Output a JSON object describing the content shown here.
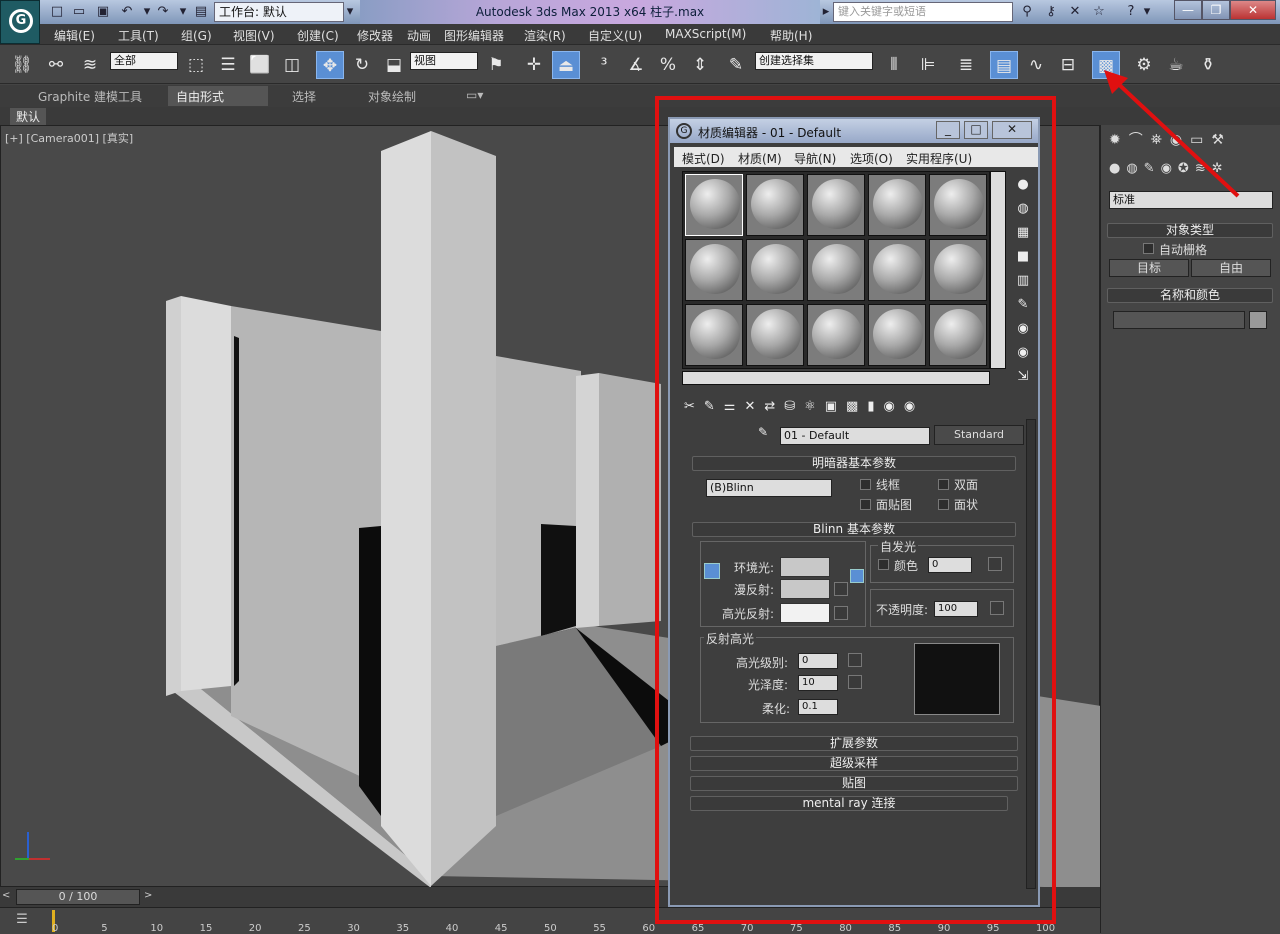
{
  "app": {
    "logo_letter": "G",
    "workspace": "工作台: 默认",
    "title": "Autodesk 3ds Max  2013 x64      柱子.max",
    "search_placeholder": "键入关键字或短语"
  },
  "menu": [
    "编辑(E)",
    "工具(T)",
    "组(G)",
    "视图(V)",
    "创建(C)",
    "修改器",
    "动画",
    "图形编辑器",
    "渲染(R)",
    "自定义(U)",
    "MAXScript(M)",
    "帮助(H)"
  ],
  "toolbar": {
    "filter_value": "全部",
    "refcoord_value": "视图",
    "selection_set_value": "创建选择集"
  },
  "ribbon": {
    "tabs": [
      "Graphite 建模工具",
      "自由形式",
      "选择",
      "对象绘制"
    ],
    "active_tab": "自由形式",
    "subtab": "默认"
  },
  "viewport": {
    "label": "[+] [Camera001] [真实]"
  },
  "timeline": {
    "frame": "0 / 100",
    "ticks": [
      "0",
      "5",
      "10",
      "15",
      "20",
      "25",
      "30",
      "35",
      "40",
      "45",
      "50",
      "55",
      "60",
      "65",
      "70",
      "75",
      "80",
      "85",
      "90",
      "95",
      "100"
    ]
  },
  "command_panel": {
    "category": "标准",
    "object_type_header": "对象类型",
    "auto_grid": "自动栅格",
    "target_btn": "目标",
    "free_btn": "自由",
    "name_color_header": "名称和颜色"
  },
  "material_editor": {
    "title": "材质编辑器 - 01 - Default",
    "menus": [
      "模式(D)",
      "材质(M)",
      "导航(N)",
      "选项(O)",
      "实用程序(U)"
    ],
    "material_name": "01 - Default",
    "material_type": "Standard",
    "shader_rollout": "明暗器基本参数",
    "shader_value": "(B)Blinn",
    "wire": "线框",
    "two_sided": "双面",
    "face_map": "面贴图",
    "faceted": "面状",
    "blinn_rollout": "Blinn 基本参数",
    "ambient": "环境光:",
    "diffuse": "漫反射:",
    "specular": "高光反射:",
    "self_illum": "自发光",
    "color": "颜色",
    "self_illum_value": "0",
    "opacity": "不透明度:",
    "opacity_value": "100",
    "spec_highlights": "反射高光",
    "spec_level": "高光级别:",
    "spec_level_value": "0",
    "glossiness": "光泽度:",
    "glossiness_value": "10",
    "soften": "柔化:",
    "soften_value": "0.1",
    "extended": "扩展参数",
    "supersampling": "超级采样",
    "maps": "贴图",
    "mentalray": "mental ray 连接"
  },
  "colors": {
    "annotation_red": "#e01010",
    "selected_blue": "#5a8fd4"
  }
}
